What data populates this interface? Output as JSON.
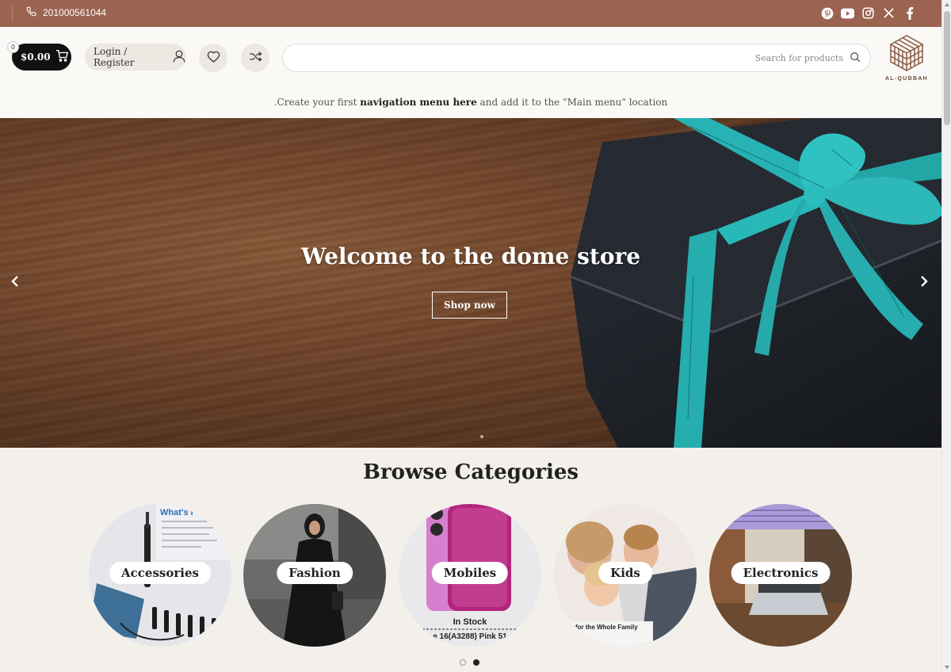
{
  "topbar": {
    "phone": "201000561044",
    "bg_color": "#9a6450",
    "social_icons": [
      "pinterest-icon",
      "youtube-icon",
      "instagram-icon",
      "x-icon",
      "facebook-icon"
    ]
  },
  "header": {
    "cart_count": "0",
    "cart_total": "$0.00",
    "login_label": "Login / Register",
    "search_placeholder": "Search for products",
    "logo_text": "AL-QUBBAH",
    "nav_note": {
      "prefix": ".Create your first ",
      "link": "navigation menu here",
      "suffix": " and add it to the \"Main menu\" location"
    }
  },
  "hero": {
    "title": "Welcome to the dome store",
    "button": "Shop now"
  },
  "categories": {
    "title": "Browse Categories",
    "items": [
      {
        "label": "Accessories"
      },
      {
        "label": "Fashion"
      },
      {
        "label": "Mobiles",
        "overlay_text_1": "In Stock",
        "overlay_text_2": "e 16(A3288) Pink 51"
      },
      {
        "label": "Kids",
        "overlay_text": "for the Whole Family"
      },
      {
        "label": "Electronics"
      }
    ],
    "accessories_box_title": "What's i",
    "pager": {
      "pages": 2,
      "active": 2
    }
  }
}
